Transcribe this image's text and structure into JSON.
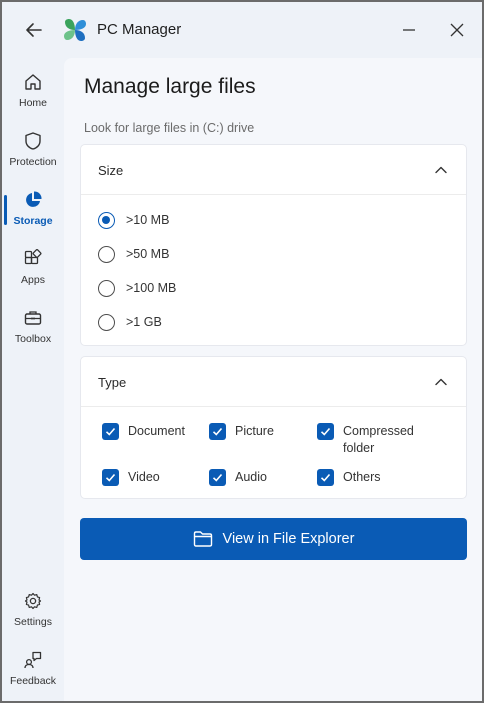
{
  "app": {
    "title": "PC Manager"
  },
  "sidebar": {
    "items": [
      {
        "label": "Home",
        "icon": "home-icon"
      },
      {
        "label": "Protection",
        "icon": "shield-icon"
      },
      {
        "label": "Storage",
        "icon": "pie-chart-icon",
        "active": true
      },
      {
        "label": "Apps",
        "icon": "apps-icon"
      },
      {
        "label": "Toolbox",
        "icon": "toolbox-icon"
      },
      {
        "label": "Settings",
        "icon": "gear-icon"
      },
      {
        "label": "Feedback",
        "icon": "feedback-icon"
      }
    ]
  },
  "main": {
    "title": "Manage large files",
    "subtitle": "Look for large files in (C:) drive",
    "size_section": {
      "label": "Size",
      "options": [
        {
          "label": ">10 MB",
          "checked": true
        },
        {
          "label": ">50 MB",
          "checked": false
        },
        {
          "label": ">100 MB",
          "checked": false
        },
        {
          "label": ">1 GB",
          "checked": false
        }
      ]
    },
    "type_section": {
      "label": "Type",
      "options": [
        {
          "label": "Document",
          "checked": true
        },
        {
          "label": "Picture",
          "checked": true
        },
        {
          "label": "Compressed folder",
          "checked": true
        },
        {
          "label": "Video",
          "checked": true
        },
        {
          "label": "Audio",
          "checked": true
        },
        {
          "label": "Others",
          "checked": true
        }
      ]
    },
    "view_button_label": "View in File Explorer"
  },
  "colors": {
    "accent": "#0a5bb5",
    "background": "#eef2f8",
    "card": "#ffffff"
  }
}
